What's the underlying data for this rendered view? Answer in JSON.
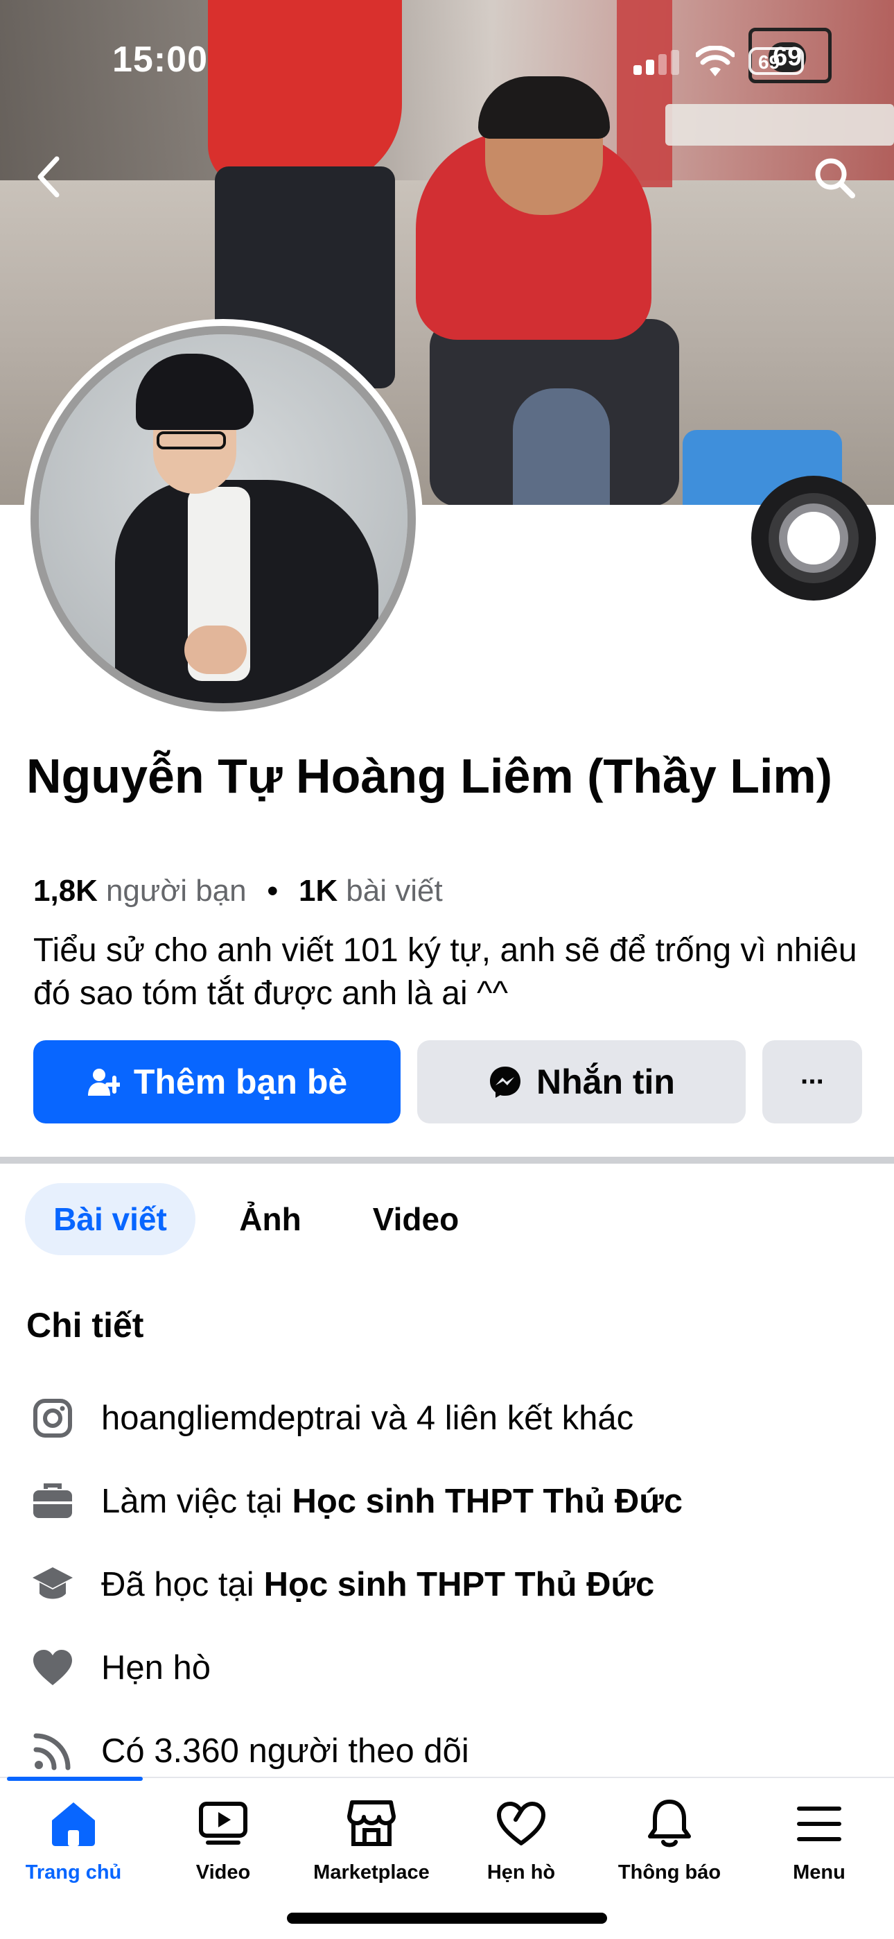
{
  "status_bar": {
    "time": "15:00",
    "battery": "69"
  },
  "cover": {
    "watermark": "69"
  },
  "profile": {
    "name": "Nguyễn Tự Hoàng Liêm (Thầy Lim)",
    "friends_count": "1,8K",
    "friends_label": "người bạn",
    "posts_count": "1K",
    "posts_label": "bài viết",
    "separator": "•",
    "bio": "Tiểu sử cho anh viết 101 ký tự, anh sẽ để trống vì nhiêu đó sao tóm tắt được anh là ai ^^"
  },
  "actions": {
    "add_friend": "Thêm bạn bè",
    "message": "Nhắn tin",
    "more": "···"
  },
  "tabs": [
    {
      "label": "Bài viết",
      "active": true
    },
    {
      "label": "Ảnh",
      "active": false
    },
    {
      "label": "Video",
      "active": false
    }
  ],
  "details": {
    "title": "Chi tiết",
    "items": [
      {
        "icon": "instagram-icon",
        "text": "hoangliemdeptrai và 4 liên kết khác",
        "bold": ""
      },
      {
        "icon": "briefcase-icon",
        "text": "Làm việc tại",
        "bold": "Học sinh THPT Thủ Đức"
      },
      {
        "icon": "graduation-cap-icon",
        "text": "Đã học tại",
        "bold": "Học sinh THPT Thủ Đức"
      },
      {
        "icon": "heart-icon",
        "text": "Hẹn hò",
        "bold": ""
      },
      {
        "icon": "rss-icon",
        "text": "Có 3.360 người theo dõi",
        "bold": ""
      }
    ]
  },
  "bottom_nav": [
    {
      "label": "Trang chủ",
      "icon": "home-icon",
      "active": true
    },
    {
      "label": "Video",
      "icon": "video-icon",
      "active": false
    },
    {
      "label": "Marketplace",
      "icon": "marketplace-icon",
      "active": false
    },
    {
      "label": "Hẹn hò",
      "icon": "dating-heart-icon",
      "active": false
    },
    {
      "label": "Thông báo",
      "icon": "bell-icon",
      "active": false
    },
    {
      "label": "Menu",
      "icon": "menu-icon",
      "active": false
    }
  ],
  "colors": {
    "primary": "#0866ff",
    "secondary_button": "#e4e6eb",
    "active_tab_bg": "#e7f0fd",
    "text": "#050505",
    "muted_text": "#65676b"
  }
}
